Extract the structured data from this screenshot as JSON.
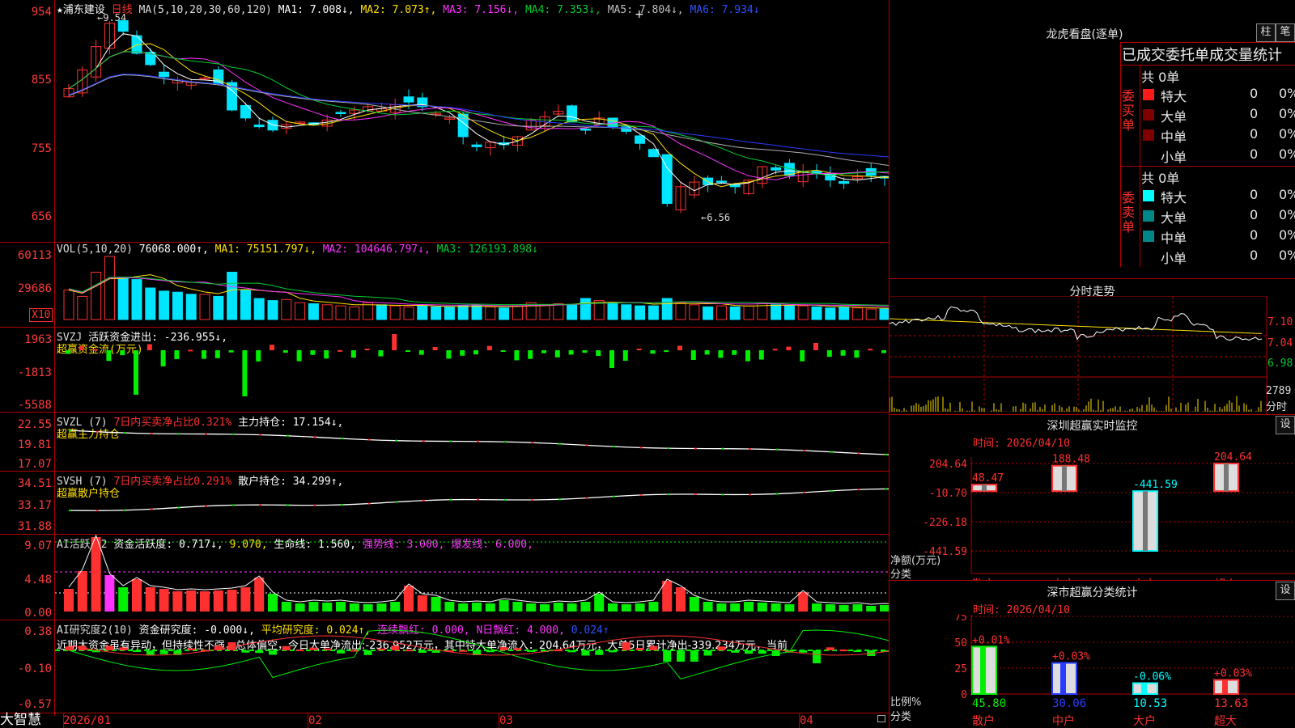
{
  "app": {
    "name": "大智慧",
    "stock": "浦东建设",
    "period": "日线"
  },
  "colors": {
    "up": "#ff3030",
    "down": "#00e5ff",
    "ma1": "#ffffff",
    "ma2": "#ffe000",
    "ma3": "#ff33ff",
    "ma4": "#00cc33",
    "ma5": "#b0b0b0",
    "ma6": "#2a3cff",
    "green": "#00ee00",
    "grid": "#b00000"
  },
  "kline": {
    "star": "★",
    "header": {
      "name": "浦东建设",
      "period": "日线",
      "ma_label": "MA(5,10,20,30,60,120)",
      "ma1": "MA1: 7.008↓,",
      "ma2": "MA2: 7.073↑,",
      "ma3": "MA3: 7.156↓,",
      "ma4": "MA4: 7.353↓,",
      "ma5": "MA5: 7.804↓,",
      "ma6": "MA6: 7.934↓"
    },
    "yticks": [
      "954",
      "855",
      "755",
      "656"
    ],
    "high_mark": "9.54",
    "low_mark": "6.56",
    "cursor": "+"
  },
  "vol": {
    "label": "VOL(5,10,20)",
    "value": "76068.000↑,",
    "ma1": "MA1: 75151.797↓,",
    "ma2": "MA2: 104646.797↓,",
    "ma3": "MA3: 126193.898↓",
    "yticks": [
      "60113",
      "29686"
    ],
    "unit": "X10"
  },
  "svzj": {
    "label": "SVZJ",
    "text": "活跃资金进出: -236.955↓,",
    "sub": "超赢资金流(万元)",
    "yticks": [
      "1963",
      "-1813",
      "-5588"
    ]
  },
  "svzl": {
    "label": "SVZL (7)",
    "pct": "7日内买卖净占比0.321%",
    "main": "主力持仓: 17.154↓,",
    "sub": "超赢主力持仓",
    "yticks": [
      "22.55",
      "19.81",
      "17.07"
    ]
  },
  "svsh": {
    "label": "SVSH (7)",
    "pct": "7日内买卖净占比0.291%",
    "main": "散户持仓: 34.299↑,",
    "sub": "超赢散户持仓",
    "yticks": [
      "34.51",
      "33.17",
      "31.88"
    ]
  },
  "ai1": {
    "label": "AI活跃度2",
    "a": "资金活跃度: 0.717↓,",
    "b": "9.070,",
    "c": "生命线: 1.560,",
    "d": "强势线: 3.000,",
    "e": "爆发线: 6.000,",
    "yticks": [
      "9.07",
      "4.48",
      "0.00"
    ]
  },
  "ai2": {
    "label": "AI研究度2(10)",
    "a": "资金研究度: -0.000↓,",
    "b": "平均研究度: 0.024↑,",
    "c": "连续飘红: 0.000,",
    "d": "N日飘红: 4.000,",
    "e": "0.024↑",
    "comment": "近期大资金虽有异动，但持续性不强，总体偏空，今日大单净流出:-236.952万元，其中特大单净流入：204.64万元，大单5日累计净出-339.234万元，当前",
    "yticks": [
      "0.38",
      "-0.10",
      "-0.57"
    ]
  },
  "xaxis": {
    "labels": [
      "2026/01",
      "02",
      "03",
      "04"
    ]
  },
  "orders": {
    "title": "龙虎看盘(逐单)",
    "btn1": "柱",
    "btn2": "笔",
    "heading": "已成交委托单成交量统计",
    "buy_side": "委买单",
    "sell_side": "委卖单",
    "buy_total": "共 0单",
    "sell_total": "共 0单",
    "buy": [
      {
        "name": "特大",
        "count": "0",
        "pct": "0%"
      },
      {
        "name": "大单",
        "count": "0",
        "pct": "0%"
      },
      {
        "name": "中单",
        "count": "0",
        "pct": "0%"
      },
      {
        "name": "小单",
        "count": "0",
        "pct": "0%"
      }
    ],
    "sell": [
      {
        "name": "特大",
        "count": "0",
        "pct": "0%"
      },
      {
        "name": "大单",
        "count": "0",
        "pct": "0%"
      },
      {
        "name": "中单",
        "count": "0",
        "pct": "0%"
      },
      {
        "name": "小单",
        "count": "0",
        "pct": "0%"
      }
    ]
  },
  "intraday": {
    "title": "分时走势",
    "yticks": [
      "7.10",
      "7.04",
      "6.98"
    ],
    "vol_label": "2789",
    "vol_unit": "分时"
  },
  "monitor": {
    "title": "深圳超赢实时监控",
    "settings": "设",
    "time": "时间: 2026/04/10",
    "ylabel": "净额(万元)",
    "xlabel": "分类",
    "yticks": [
      "204.64",
      "-10.70",
      "-226.18",
      "-441.59"
    ],
    "categories": [
      "散户",
      "中户",
      "大户",
      "超大"
    ],
    "values": [
      48.47,
      188.48,
      -441.59,
      204.64
    ],
    "value_labels": [
      "48.47",
      "188.48",
      "-441.59",
      "204.64"
    ]
  },
  "classify": {
    "title": "深市超赢分类统计",
    "settings": "设",
    "time": "时间: 2026/04/10",
    "ylabel": "比例%",
    "xlabel": "分类",
    "yticks": [
      "75",
      "50",
      "25",
      "0"
    ],
    "categories": [
      "散户",
      "中户",
      "大户",
      "超大"
    ],
    "values": [
      45.8,
      30.06,
      10.53,
      13.63
    ],
    "value_labels": [
      "45.80",
      "30.06",
      "10.53",
      "13.63"
    ],
    "changes": [
      "+0.01%",
      "+0.03%",
      "-0.06%",
      "+0.03%"
    ]
  },
  "chart_data": [
    {
      "type": "bar",
      "title": "深圳超赢实时监控",
      "ylabel": "净额(万元)",
      "xlabel": "分类",
      "categories": [
        "散户",
        "中户",
        "大户",
        "超大"
      ],
      "values": [
        48.47,
        188.48,
        -441.59,
        204.64
      ],
      "ylim": [
        -441.59,
        204.64
      ]
    },
    {
      "type": "bar",
      "title": "深市超赢分类统计",
      "ylabel": "比例%",
      "xlabel": "分类",
      "categories": [
        "散户",
        "中户",
        "大户",
        "超大"
      ],
      "values": [
        45.8,
        30.06,
        10.53,
        13.63
      ],
      "ylim": [
        0,
        75
      ]
    }
  ]
}
